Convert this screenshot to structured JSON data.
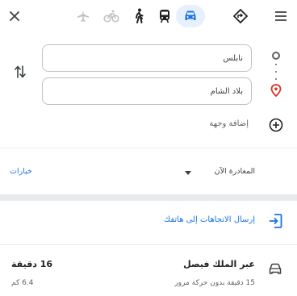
{
  "toolbar": {
    "close_icon": "close-icon",
    "modes": [
      "airplane-icon",
      "bicycle-icon",
      "walk-icon",
      "transit-icon",
      "car-icon",
      "directions-icon"
    ],
    "active_mode": "car-icon",
    "menu_icon": "menu-icon",
    "accent_color": "#1a73e8"
  },
  "route_inputs": {
    "origin_value": "نابلس",
    "destination_value": "بلاد الشام",
    "add_stop_label": "إضافة وجهة"
  },
  "options_bar": {
    "options_label": "خيارات",
    "depart_label": "المغادرة الآن"
  },
  "send": {
    "label": "إرسال الاتجاهات إلى هاتفك"
  },
  "route": {
    "name": "عبر الملك فيصل",
    "subtitle": "15 دقيقة بدون حركة مرور",
    "time": "16 دقيقة",
    "distance": "6.4 كم"
  }
}
